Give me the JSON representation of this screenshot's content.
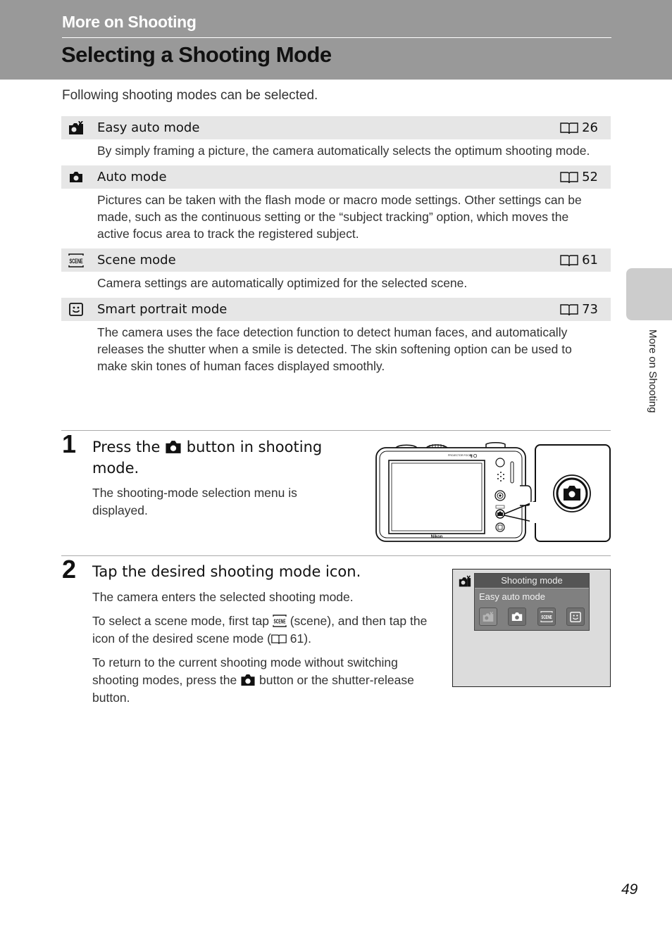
{
  "header": {
    "section": "More on Shooting",
    "title": "Selecting a Shooting Mode"
  },
  "intro": "Following shooting modes can be selected.",
  "modes": [
    {
      "icon": "easy-auto-icon",
      "name": "Easy auto mode",
      "page": "26",
      "description": "By simply framing a picture, the camera automatically selects the optimum shooting mode."
    },
    {
      "icon": "camera-auto-icon",
      "name": "Auto mode",
      "page": "52",
      "description": "Pictures can be taken with the flash mode or macro mode settings. Other settings can be made, such as the continuous setting or the “subject tracking” option, which moves the active focus area to track the registered subject."
    },
    {
      "icon": "scene-icon",
      "name": "Scene mode",
      "page": "61",
      "description": "Camera settings are automatically optimized for the selected scene."
    },
    {
      "icon": "smile-icon",
      "name": "Smart portrait mode",
      "page": "73",
      "description": "The camera uses the face detection function to detect human faces, and automatically releases the shutter when a smile is detected. The skin softening option can be used to make skin tones of human faces displayed smoothly."
    }
  ],
  "side_tab": "More on Shooting",
  "steps": [
    {
      "number": "1",
      "title_before": "Press the",
      "title_after": "button in shooting mode.",
      "text": "The shooting-mode selection menu is displayed."
    },
    {
      "number": "2",
      "title": "Tap the desired shooting mode icon.",
      "text1": "The camera enters the selected shooting mode.",
      "text2_before": "To select a scene mode, first tap",
      "text2_middle": "(scene), and then tap the icon of the desired scene mode (",
      "text2_ref": "61).",
      "text3_before": "To return to the current shooting mode without switching shooting modes, press the",
      "text3_after": "button or the shutter-release button."
    }
  ],
  "camera_figure": {
    "brand": "Nikon",
    "label_top": "PROJECTOR FOCUS"
  },
  "screen_figure": {
    "menu_title": "Shooting mode",
    "selected_mode": "Easy auto mode",
    "icons": [
      "easy-auto-icon",
      "camera-auto-icon",
      "scene-icon",
      "smile-icon"
    ]
  },
  "page_number": "49"
}
